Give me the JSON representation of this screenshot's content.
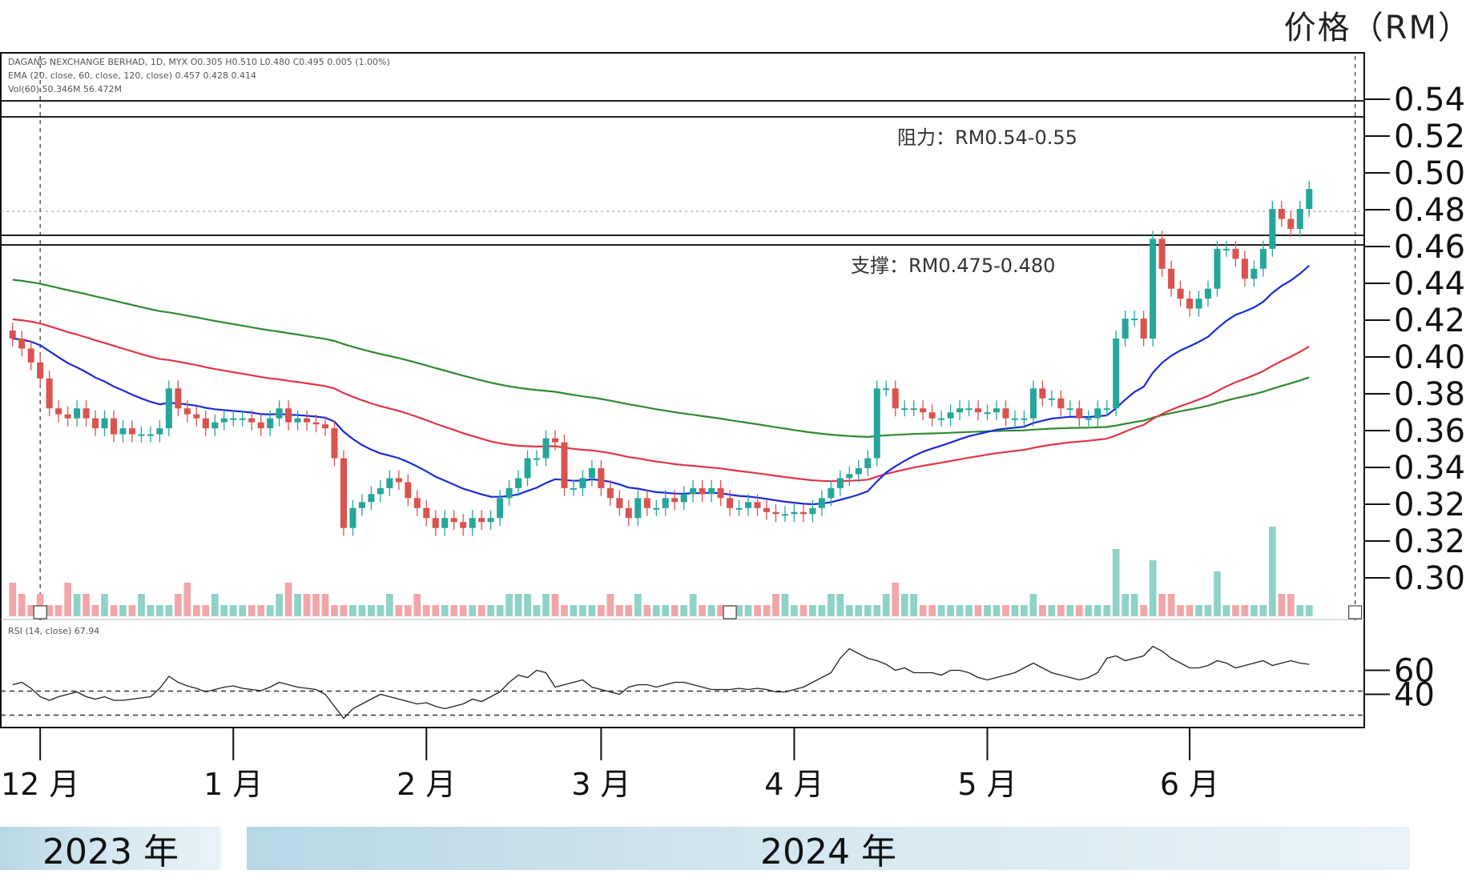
{
  "unit_label": "价格（RM）",
  "header": {
    "line1": "DAGANG NEXCHANGE BERHAD, 1D, MYX  O0.305  H0.510  L0.480  C0.495  0.005 (1.00%)",
    "line2": "EMA (20, close, 60, close, 120, close)  0.457  0.428  0.414",
    "line3": "Vol(60)  50.346M  56.472M"
  },
  "rsi_header": "RSI (14, close)  67.94",
  "annotations": {
    "resistance": "阻力：RM0.54-0.55",
    "support": "支撑：RM0.475-0.480"
  },
  "years": [
    "2023 年",
    "2024 年"
  ],
  "chart_data": {
    "type": "candlestick",
    "title": "",
    "y_unit": "价格（RM）",
    "price_tick_labels": [
      "0.54",
      "0.52",
      "0.50",
      "0.48",
      "0.46",
      "0.44",
      "0.42",
      "0.40",
      "0.38",
      "0.36",
      "0.34",
      "0.32",
      "0.32",
      "0.30"
    ],
    "price_tick_values": [
      0.54,
      0.52,
      0.5,
      0.48,
      0.46,
      0.44,
      0.42,
      0.4,
      0.38,
      0.36,
      0.34,
      0.32,
      0.3,
      0.28
    ],
    "rsi_tick_labels": [
      "60",
      "40"
    ],
    "rsi_tick_values": [
      60,
      40
    ],
    "rsi_range": [
      15,
      95
    ],
    "ylim": [
      0.27,
      0.565
    ],
    "x_tick_labels": [
      "12 月",
      "1 月",
      "2 月",
      "3 月",
      "4 月",
      "5 月",
      "6 月"
    ],
    "x_tick_index": [
      3,
      24,
      45,
      64,
      85,
      106,
      128
    ],
    "resistance_zone": [
      0.54,
      0.55
    ],
    "support_zone": [
      0.475,
      0.48
    ],
    "last_close": 0.495,
    "series_colors": {
      "up": "#26a69a",
      "down": "#d9534f",
      "ema20": "#1a2bd6",
      "ema60": "#e0344a",
      "ema120": "#2e8b2e",
      "rsi": "#222222"
    },
    "closes": [
      0.42,
      0.415,
      0.408,
      0.4,
      0.385,
      0.382,
      0.38,
      0.385,
      0.38,
      0.375,
      0.38,
      0.372,
      0.375,
      0.372,
      0.372,
      0.372,
      0.375,
      0.395,
      0.385,
      0.382,
      0.38,
      0.375,
      0.378,
      0.38,
      0.38,
      0.38,
      0.378,
      0.375,
      0.38,
      0.385,
      0.378,
      0.38,
      0.378,
      0.377,
      0.375,
      0.36,
      0.325,
      0.335,
      0.338,
      0.342,
      0.345,
      0.35,
      0.348,
      0.34,
      0.335,
      0.33,
      0.325,
      0.33,
      0.328,
      0.325,
      0.33,
      0.328,
      0.33,
      0.34,
      0.345,
      0.35,
      0.36,
      0.36,
      0.37,
      0.368,
      0.345,
      0.345,
      0.35,
      0.355,
      0.345,
      0.34,
      0.335,
      0.33,
      0.34,
      0.335,
      0.335,
      0.34,
      0.338,
      0.342,
      0.345,
      0.342,
      0.345,
      0.34,
      0.335,
      0.335,
      0.338,
      0.335,
      0.333,
      0.332,
      0.332,
      0.333,
      0.332,
      0.335,
      0.34,
      0.345,
      0.35,
      0.352,
      0.355,
      0.36,
      0.395,
      0.395,
      0.385,
      0.385,
      0.385,
      0.383,
      0.38,
      0.38,
      0.383,
      0.385,
      0.385,
      0.383,
      0.383,
      0.385,
      0.38,
      0.38,
      0.38,
      0.395,
      0.39,
      0.39,
      0.385,
      0.385,
      0.38,
      0.38,
      0.385,
      0.385,
      0.42,
      0.43,
      0.43,
      0.42,
      0.47,
      0.455,
      0.445,
      0.44,
      0.435,
      0.44,
      0.445,
      0.465,
      0.465,
      0.46,
      0.45,
      0.455,
      0.465,
      0.485,
      0.48,
      0.475,
      0.485,
      0.495
    ],
    "volumes": [
      3,
      2,
      1,
      2,
      1,
      1,
      3,
      2,
      2,
      1,
      2,
      1,
      1,
      1,
      2,
      1,
      1,
      1,
      2,
      3,
      1,
      1,
      2,
      1,
      1,
      1,
      1,
      1,
      1,
      2,
      3,
      2,
      2,
      2,
      2,
      1,
      1,
      1,
      1,
      1,
      1,
      2,
      1,
      1,
      2,
      1,
      1,
      1,
      1,
      1,
      1,
      1,
      1,
      1,
      2,
      2,
      2,
      1,
      2,
      2,
      1,
      1,
      1,
      1,
      1,
      2,
      1,
      1,
      2,
      1,
      1,
      1,
      1,
      1,
      2,
      1,
      1,
      1,
      1,
      1,
      1,
      1,
      1,
      2,
      2,
      1,
      1,
      1,
      1,
      2,
      2,
      1,
      1,
      1,
      1,
      2,
      3,
      2,
      2,
      1,
      1,
      1,
      1,
      1,
      1,
      1,
      1,
      1,
      1,
      1,
      1,
      2,
      1,
      1,
      1,
      1,
      1,
      1,
      1,
      1,
      6,
      2,
      2,
      1,
      5,
      2,
      2,
      1,
      1,
      1,
      1,
      4,
      1,
      1,
      1,
      1,
      1,
      8,
      2,
      2,
      1,
      1
    ],
    "rsi": [
      48,
      50,
      45,
      38,
      35,
      38,
      40,
      42,
      38,
      36,
      38,
      35,
      35,
      36,
      37,
      38,
      45,
      55,
      50,
      47,
      45,
      42,
      44,
      46,
      47,
      45,
      44,
      43,
      46,
      50,
      48,
      46,
      45,
      44,
      40,
      30,
      20,
      28,
      32,
      36,
      40,
      38,
      36,
      34,
      32,
      33,
      30,
      28,
      30,
      32,
      36,
      34,
      38,
      42,
      50,
      56,
      54,
      60,
      58,
      46,
      48,
      50,
      52,
      46,
      44,
      42,
      40,
      46,
      48,
      48,
      46,
      48,
      50,
      50,
      48,
      46,
      44,
      44,
      44,
      45,
      44,
      45,
      44,
      42,
      42,
      44,
      46,
      50,
      54,
      58,
      70,
      78,
      74,
      70,
      68,
      65,
      60,
      62,
      58,
      58,
      58,
      56,
      60,
      60,
      58,
      54,
      52,
      54,
      56,
      58,
      62,
      66,
      62,
      58,
      56,
      54,
      52,
      54,
      58,
      70,
      72,
      68,
      70,
      72,
      80,
      76,
      70,
      66,
      62,
      62,
      64,
      68,
      66,
      62,
      64,
      66,
      68,
      64,
      66,
      68,
      66,
      65
    ]
  }
}
